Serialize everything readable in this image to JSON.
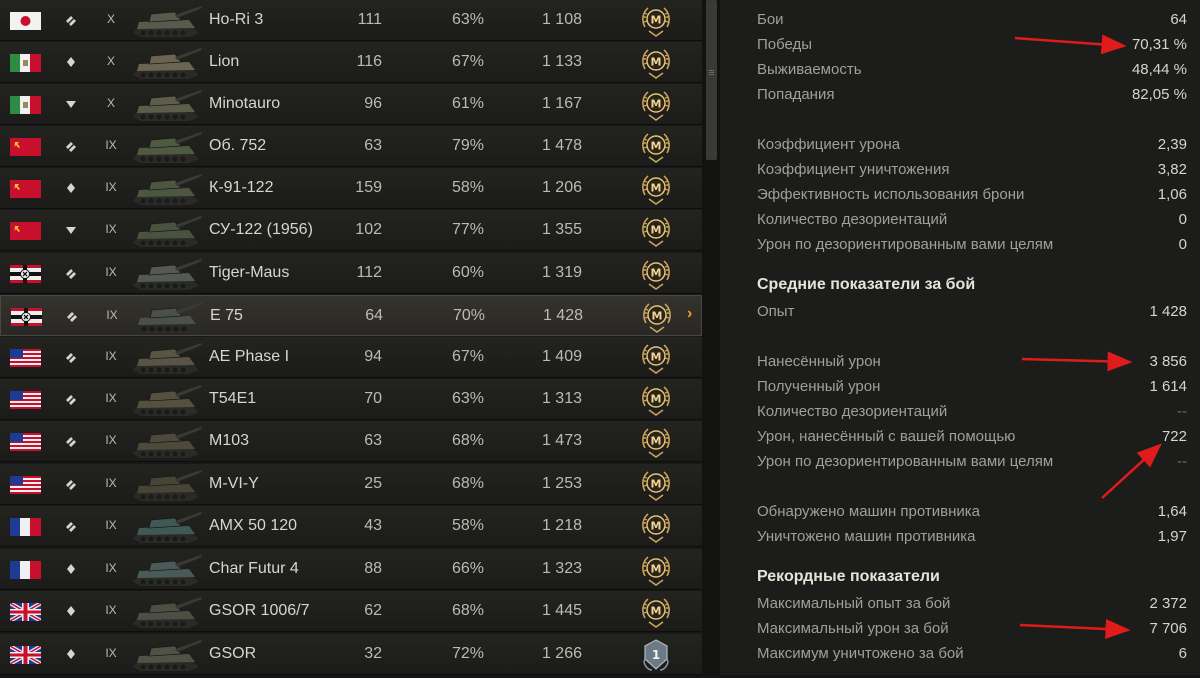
{
  "vehicles": [
    {
      "flag": "japan",
      "type": "heavy",
      "tier": "X",
      "name": "Ho-Ri 3",
      "battles": "111",
      "winrate": "63%",
      "exp": "1 108",
      "mark": "mastery"
    },
    {
      "flag": "italy",
      "type": "medium",
      "tier": "X",
      "name": "Lion",
      "battles": "116",
      "winrate": "67%",
      "exp": "1 133",
      "mark": "mastery"
    },
    {
      "flag": "italy",
      "type": "td",
      "tier": "X",
      "name": "Minotauro",
      "battles": "96",
      "winrate": "61%",
      "exp": "1 167",
      "mark": "mastery"
    },
    {
      "flag": "ussr",
      "type": "heavy",
      "tier": "IX",
      "name": "Об. 752",
      "battles": "63",
      "winrate": "79%",
      "exp": "1 478",
      "mark": "mastery"
    },
    {
      "flag": "ussr",
      "type": "medium",
      "tier": "IX",
      "name": "К-91-122",
      "battles": "159",
      "winrate": "58%",
      "exp": "1 206",
      "mark": "mastery"
    },
    {
      "flag": "ussr",
      "type": "td",
      "tier": "IX",
      "name": "СУ-122 (1956)",
      "battles": "102",
      "winrate": "77%",
      "exp": "1 355",
      "mark": "mastery"
    },
    {
      "flag": "germany",
      "type": "heavy",
      "tier": "IX",
      "name": "Tiger-Maus",
      "battles": "112",
      "winrate": "60%",
      "exp": "1 319",
      "mark": "mastery"
    },
    {
      "flag": "germany",
      "type": "heavy",
      "tier": "IX",
      "name": "E 75",
      "battles": "64",
      "winrate": "70%",
      "exp": "1 428",
      "mark": "mastery",
      "selected": true
    },
    {
      "flag": "usa",
      "type": "heavy",
      "tier": "IX",
      "name": "AE Phase I",
      "battles": "94",
      "winrate": "67%",
      "exp": "1 409",
      "mark": "mastery"
    },
    {
      "flag": "usa",
      "type": "heavy",
      "tier": "IX",
      "name": "T54E1",
      "battles": "70",
      "winrate": "63%",
      "exp": "1 313",
      "mark": "mastery"
    },
    {
      "flag": "usa",
      "type": "heavy",
      "tier": "IX",
      "name": "M103",
      "battles": "63",
      "winrate": "68%",
      "exp": "1 473",
      "mark": "mastery"
    },
    {
      "flag": "usa",
      "type": "heavy",
      "tier": "IX",
      "name": "M-VI-Y",
      "battles": "25",
      "winrate": "68%",
      "exp": "1 253",
      "mark": "mastery"
    },
    {
      "flag": "france",
      "type": "heavy",
      "tier": "IX",
      "name": "AMX 50 120",
      "battles": "43",
      "winrate": "58%",
      "exp": "1 218",
      "mark": "mastery"
    },
    {
      "flag": "france",
      "type": "medium",
      "tier": "IX",
      "name": "Char Futur 4",
      "battles": "88",
      "winrate": "66%",
      "exp": "1 323",
      "mark": "mastery"
    },
    {
      "flag": "uk",
      "type": "medium",
      "tier": "IX",
      "name": "GSOR 1006/7",
      "battles": "62",
      "winrate": "68%",
      "exp": "1 445",
      "mark": "mastery"
    },
    {
      "flag": "uk",
      "type": "medium",
      "tier": "IX",
      "name": "GSOR",
      "battles": "32",
      "winrate": "72%",
      "exp": "1 266",
      "mark": "first",
      "mark_label": "1"
    }
  ],
  "selected_chevron": "›",
  "scroll_grip": "≡",
  "mastery_letter": "M",
  "stats": {
    "general": [
      {
        "label": "Бои",
        "value": "64"
      },
      {
        "label": "Победы",
        "value": "70,31 %"
      },
      {
        "label": "Выживаемость",
        "value": "48,44 %"
      },
      {
        "label": "Попадания",
        "value": "82,05 %"
      }
    ],
    "coefficients": [
      {
        "label": "Коэффициент урона",
        "value": "2,39"
      },
      {
        "label": "Коэффициент уничтожения",
        "value": "3,82"
      },
      {
        "label": "Эффективность использования брони",
        "value": "1,06"
      },
      {
        "label": "Количество дезориентаций",
        "value": "0"
      },
      {
        "label": "Урон по дезориентированным вами целям",
        "value": "0"
      }
    ],
    "average_title": "Средние показатели за бой",
    "average_exp": {
      "label": "Опыт",
      "value": "1 428"
    },
    "average_damage": [
      {
        "label": "Нанесённый урон",
        "value": "3 856"
      },
      {
        "label": "Полученный урон",
        "value": "1 614"
      },
      {
        "label": "Количество дезориентаций",
        "value": "--"
      },
      {
        "label": "Урон, нанесённый с вашей помощью",
        "value": "722"
      },
      {
        "label": "Урон по дезориентированным вами целям",
        "value": "--"
      }
    ],
    "average_spotting": [
      {
        "label": "Обнаружено машин противника",
        "value": "1,64"
      },
      {
        "label": "Уничтожено машин противника",
        "value": "1,97"
      }
    ],
    "records_title": "Рекордные показатели",
    "records": [
      {
        "label": "Максимальный опыт за бой",
        "value": "2 372"
      },
      {
        "label": "Максимальный урон за бой",
        "value": "7 706"
      },
      {
        "label": "Максимум уничтожено за бой",
        "value": "6"
      }
    ]
  },
  "colors": {
    "accent_arrow": "#e01b1b",
    "mastery_gold": "#c9a35a",
    "chevron": "#e8a22a"
  }
}
